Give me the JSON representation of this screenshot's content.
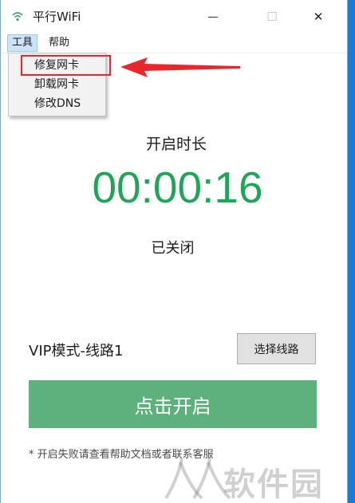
{
  "window": {
    "title": "平行WiFi",
    "icon": "wifi-icon",
    "minimize_glyph": "—",
    "maximize_glyph": "☐",
    "close_glyph": "✕"
  },
  "menubar": {
    "items": [
      {
        "label": "工具",
        "open": true
      },
      {
        "label": "帮助",
        "open": false
      }
    ]
  },
  "dropdown": {
    "items": [
      {
        "label": "修复网卡",
        "highlighted": true
      },
      {
        "label": "卸载网卡"
      },
      {
        "label": "修改DNS"
      }
    ]
  },
  "main": {
    "duration_label": "开启时长",
    "timer": "00:00:16",
    "status": "已关闭",
    "mode_label": "VIP模式-线路1",
    "select_line_button": "选择线路",
    "start_button": "点击开启",
    "footnote": "* 开启失败请查看帮助文档或者联系客服"
  },
  "annotation": {
    "color": "#e6282c"
  },
  "watermark": {
    "text": "软件园"
  },
  "colors": {
    "timer": "#20a558",
    "start_button": "#5db17b",
    "menu_active": "#cce4f7"
  }
}
